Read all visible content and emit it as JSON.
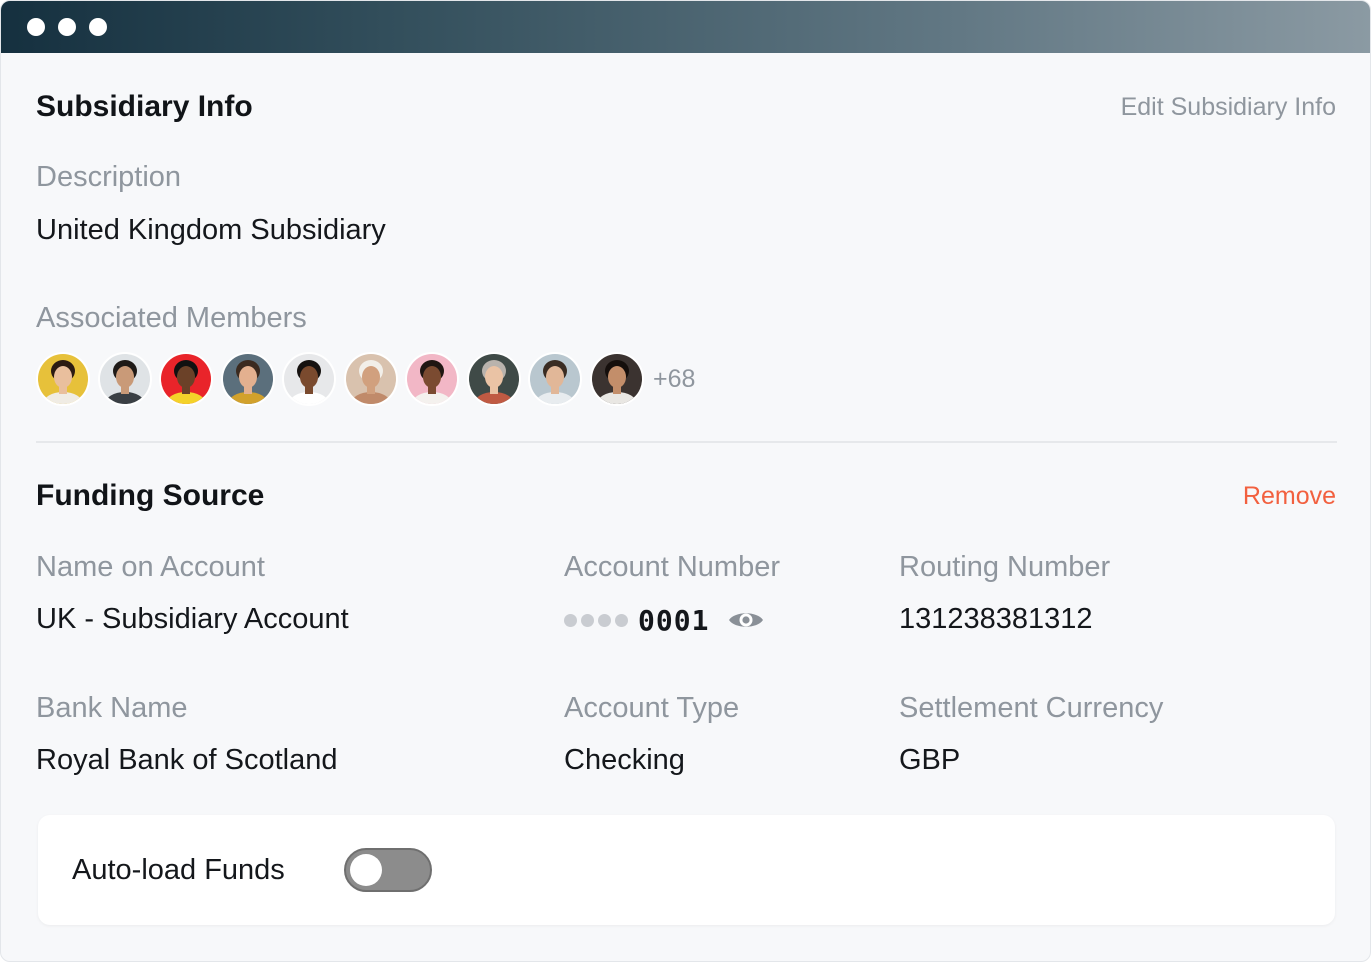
{
  "window": {
    "controls": [
      "window-dot",
      "window-dot",
      "window-dot"
    ]
  },
  "subsidiary": {
    "title": "Subsidiary Info",
    "edit_label": "Edit Subsidiary Info",
    "description_label": "Description",
    "description_value": "United Kingdom Subsidiary",
    "members_label": "Associated Members",
    "more_members": "+68",
    "avatars": [
      {
        "bg": "#e7c13a",
        "skin": "#e9bf9d",
        "hair": "#2b1b12",
        "shirt": "#f0ece4"
      },
      {
        "bg": "#dfe3e6",
        "skin": "#c99a78",
        "hair": "#1e1a17",
        "shirt": "#3a3f44"
      },
      {
        "bg": "#e9242a",
        "skin": "#6b4128",
        "hair": "#111111",
        "shirt": "#f4d22a"
      },
      {
        "bg": "#5b6f7c",
        "skin": "#e3b08f",
        "hair": "#3b2a1f",
        "shirt": "#d2a12c"
      },
      {
        "bg": "#e7e8ea",
        "skin": "#7a4a2e",
        "hair": "#161210",
        "shirt": "#ffffff"
      },
      {
        "bg": "#d9c2ae",
        "skin": "#d1a07e",
        "hair": "#f2efe9",
        "shirt": "#c08a6a"
      },
      {
        "bg": "#f2b7c6",
        "skin": "#7b4b31",
        "hair": "#1f1612",
        "shirt": "#f4f1ee"
      },
      {
        "bg": "#3f4a47",
        "skin": "#eac3a5",
        "hair": "#b9b3ad",
        "shirt": "#c05a43"
      },
      {
        "bg": "#b9c7cf",
        "skin": "#e1b798",
        "hair": "#3a2c22",
        "shirt": "#e8ecef"
      },
      {
        "bg": "#3b3330",
        "skin": "#c38e6a",
        "hair": "#150f0c",
        "shirt": "#e9e7e3"
      }
    ]
  },
  "funding": {
    "title": "Funding Source",
    "remove_label": "Remove",
    "name_label": "Name on Account",
    "name_value": "UK - Subsidiary Account",
    "account_number_label": "Account Number",
    "account_number_last4": "0001",
    "reveal_icon": "eye-icon",
    "routing_label": "Routing Number",
    "routing_value": "131238381312",
    "bank_label": "Bank Name",
    "bank_value": "Royal Bank of Scotland",
    "type_label": "Account Type",
    "type_value": "Checking",
    "currency_label": "Settlement Currency",
    "currency_value": "GBP"
  },
  "autoload": {
    "label": "Auto-load Funds",
    "enabled": false
  },
  "colors": {
    "accent_danger": "#f2603f",
    "link_muted": "#8f969e",
    "toggle_off": "#8c8c8c"
  }
}
